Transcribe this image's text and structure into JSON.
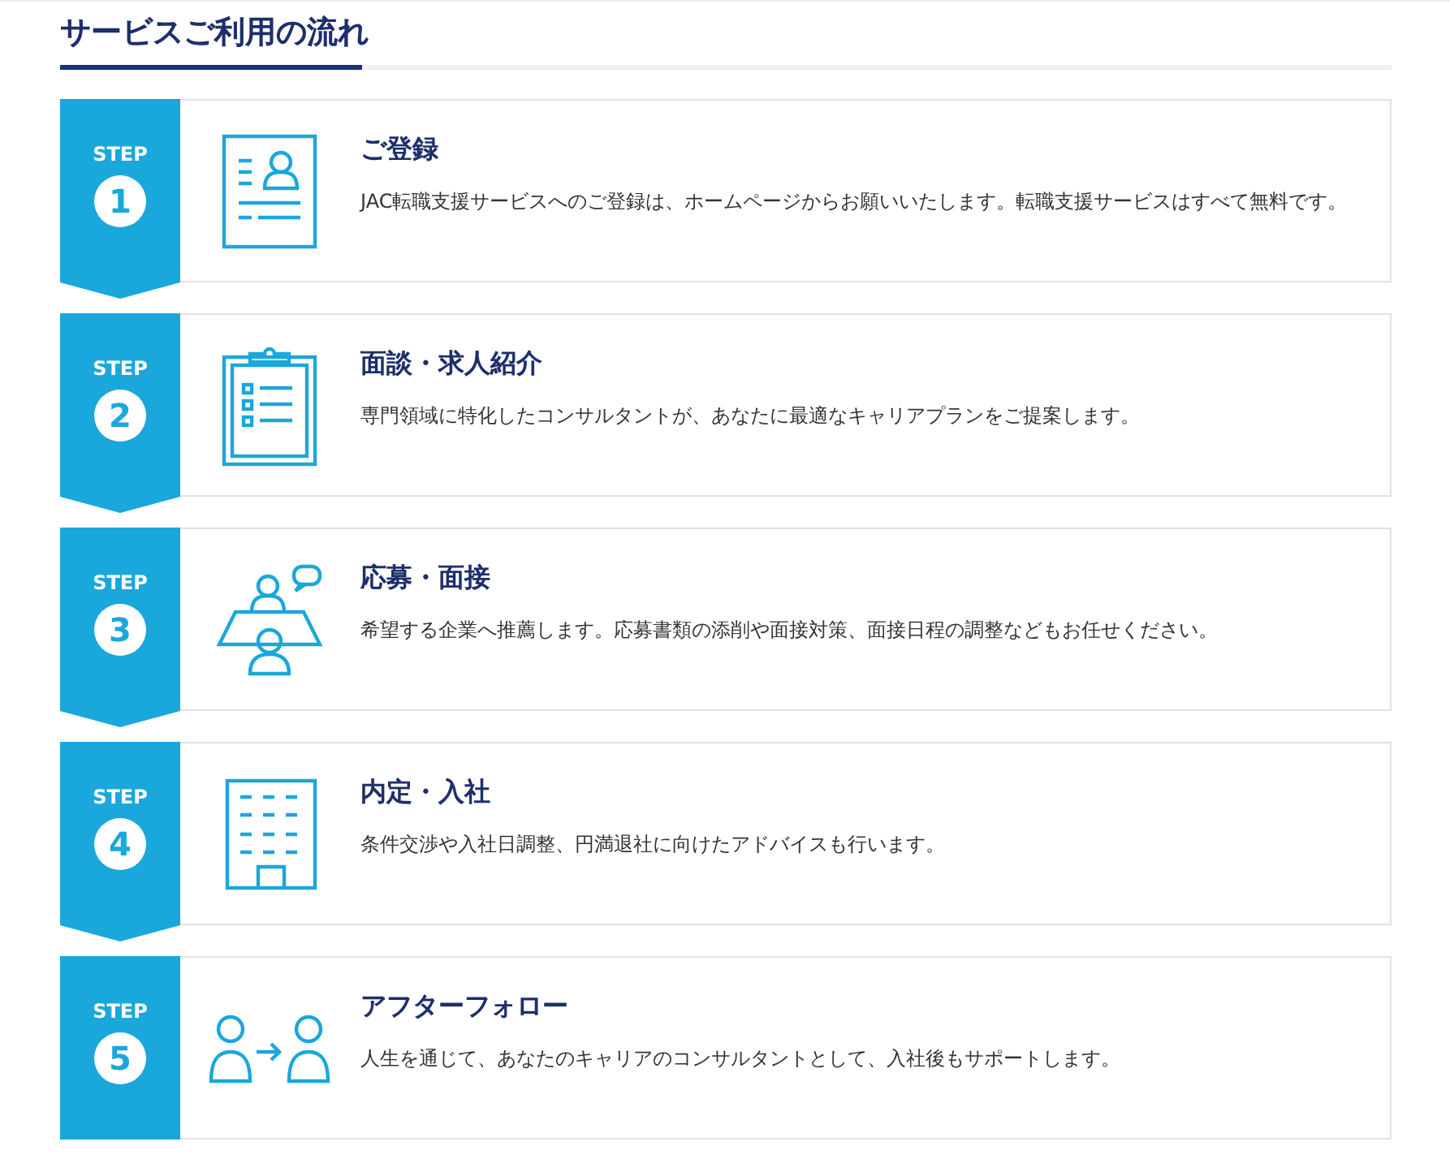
{
  "heading": "サービスご利用の流れ",
  "steps": [
    {
      "step_label": "STEP",
      "number": "1",
      "title": "ご登録",
      "description": "JAC転職支援サービスへのご登録は、ホームページからお願いいたします。転職支援サービスはすべて無料です。"
    },
    {
      "step_label": "STEP",
      "number": "2",
      "title": "面談・求人紹介",
      "description": "専門領域に特化したコンサルタントが、あなたに最適なキャリアプランをご提案します。"
    },
    {
      "step_label": "STEP",
      "number": "3",
      "title": "応募・面接",
      "description": "希望する企業へ推薦します。応募書類の添削や面接対策、面接日程の調整などもお任せください。"
    },
    {
      "step_label": "STEP",
      "number": "4",
      "title": "内定・入社",
      "description": "条件交渉や入社日調整、円満退社に向けたアドバイスも行います。"
    },
    {
      "step_label": "STEP",
      "number": "5",
      "title": "アフターフォロー",
      "description": "人生を通じて、あなたのキャリアのコンサルタントとして、入社後もサポートします。"
    }
  ]
}
